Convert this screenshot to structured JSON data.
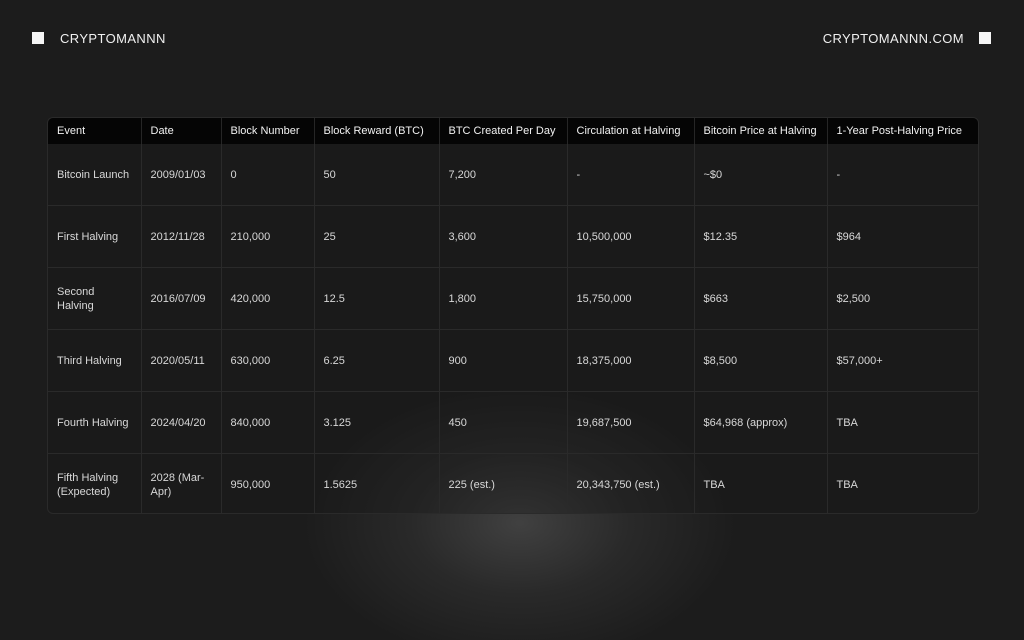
{
  "header": {
    "brand_left": "CRYPTOMANNN",
    "brand_right": "CRYPTOMANNN.COM"
  },
  "table": {
    "columns": [
      "Event",
      "Date",
      "Block Number",
      "Block Reward (BTC)",
      "BTC Created Per Day",
      "Circulation at Halving",
      "Bitcoin Price at Halving",
      "1-Year Post-Halving Price"
    ],
    "rows": [
      [
        "Bitcoin Launch",
        "2009/01/03",
        "0",
        "50",
        "7,200",
        "-",
        "~$0",
        "-"
      ],
      [
        "First Halving",
        "2012/11/28",
        "210,000",
        "25",
        "3,600",
        "10,500,000",
        "$12.35",
        "$964"
      ],
      [
        "Second Halving",
        "2016/07/09",
        "420,000",
        "12.5",
        "1,800",
        "15,750,000",
        "$663",
        "$2,500"
      ],
      [
        "Third Halving",
        "2020/05/11",
        "630,000",
        "6.25",
        "900",
        "18,375,000",
        "$8,500",
        "$57,000+"
      ],
      [
        "Fourth Halving",
        "2024/04/20",
        "840,000",
        "3.125",
        "450",
        "19,687,500",
        "$64,968 (approx)",
        "TBA"
      ],
      [
        "Fifth Halving (Expected)",
        "2028 (Mar-Apr)",
        "950,000",
        "1.5625",
        "225 (est.)",
        "20,343,750 (est.)",
        "TBA",
        "TBA"
      ]
    ]
  }
}
